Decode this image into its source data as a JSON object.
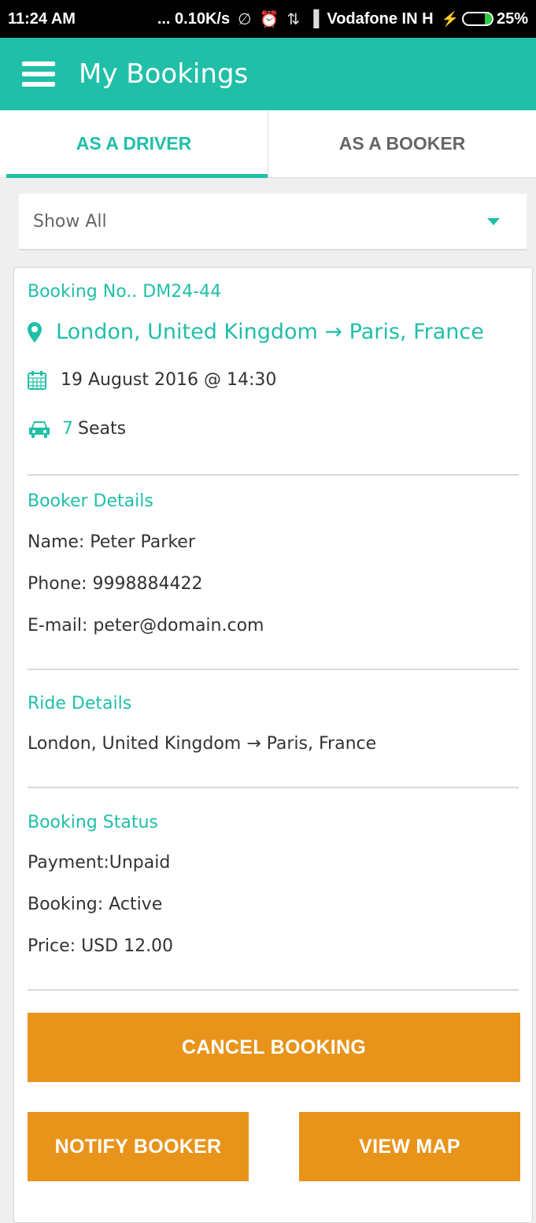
{
  "status_bar": {
    "time": "11:24 AM",
    "speed": "... 0.10K/s",
    "carrier": "Vodafone IN H",
    "battery": "25%",
    "battery_level": 0.25
  },
  "app_bar": {
    "title": "My Bookings"
  },
  "tabs": [
    {
      "label": "AS A DRIVER",
      "active": true
    },
    {
      "label": "AS A BOOKER",
      "active": false
    }
  ],
  "filter": {
    "selected": "Show All"
  },
  "booking": {
    "number": "Booking No.. DM24-44",
    "route": "London, United Kingdom → Paris, France",
    "datetime": "19 August 2016 @ 14:30",
    "seats_count": "7",
    "seats_label": "Seats",
    "booker_title": "Booker Details",
    "booker_name": "Name: Peter Parker",
    "booker_phone": "Phone: 9998884422",
    "booker_email": "E-mail: peter@domain.com",
    "ride_title": "Ride Details",
    "ride_route": "London, United Kingdom → Paris, France",
    "status_title": "Booking Status",
    "payment": "Payment:Unpaid",
    "booking_state": "Booking: Active",
    "price": "Price: USD 12.00"
  },
  "actions": {
    "cancel": "CANCEL BOOKING",
    "notify": "NOTIFY BOOKER",
    "map": "VIEW MAP"
  },
  "colors": {
    "accent": "#20bfa8",
    "button": "#e8941a"
  }
}
